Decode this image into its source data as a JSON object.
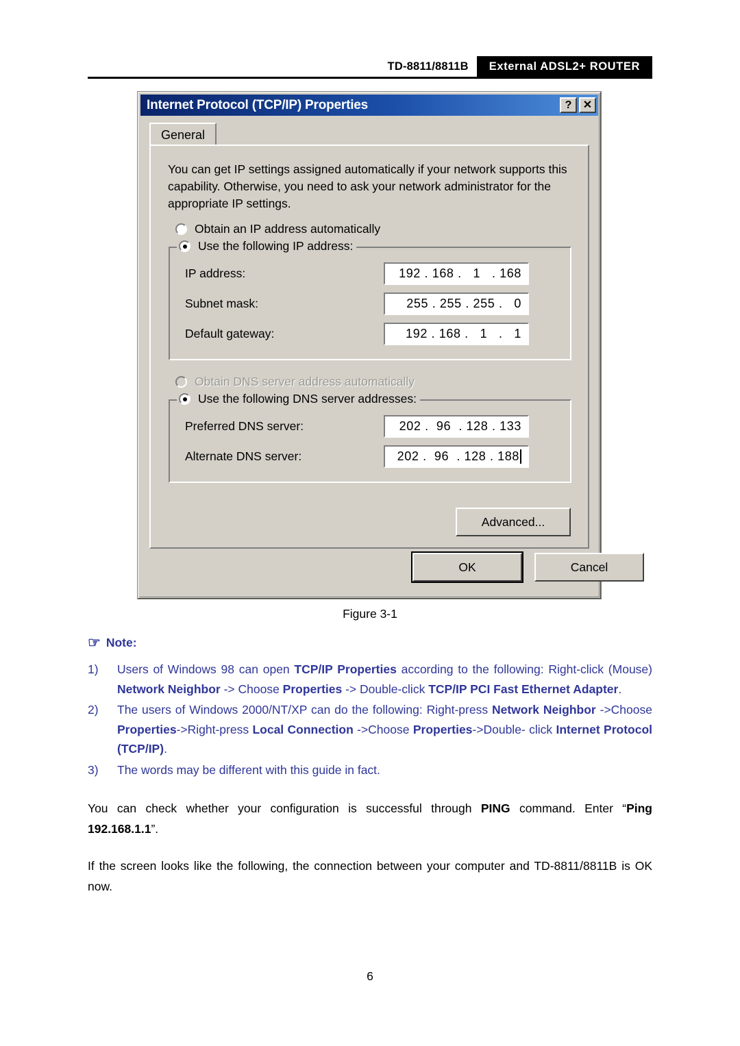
{
  "header": {
    "model": "TD-8811/8811B",
    "product": "External  ADSL2+  ROUTER"
  },
  "dialog": {
    "title": "Internet Protocol (TCP/IP) Properties",
    "help_button": "?",
    "close_button": "✕",
    "tab": "General",
    "description": "You can get IP settings assigned automatically if your network supports this capability. Otherwise, you need to ask your network administrator for the appropriate IP settings.",
    "ip_section": {
      "obtain_auto_label_pre": "O",
      "obtain_auto_label_accel": "b",
      "obtain_auto_label_post": "tain an IP address automatically",
      "obtain_auto_label": "Obtain an IP address automatically",
      "obtain_auto_selected": false,
      "use_following_label": "Use the following IP address:",
      "use_following_selected": true,
      "fields": [
        {
          "label": "IP address:",
          "value": "192 . 168 .   1   . 168",
          "caret": false
        },
        {
          "label": "Subnet mask:",
          "value": "255 . 255 . 255 .   0",
          "caret": false
        },
        {
          "label": "Default gateway:",
          "value": "192 . 168 .   1   .   1",
          "caret": false
        }
      ]
    },
    "dns_section": {
      "obtain_auto_label": "Obtain DNS server address automatically",
      "obtain_auto_selected": false,
      "obtain_auto_disabled": true,
      "use_following_label": "Use the following DNS server addresses:",
      "use_following_selected": true,
      "fields": [
        {
          "label": "Preferred DNS server:",
          "value": "202 .  96  . 128 . 133",
          "caret": false
        },
        {
          "label": "Alternate DNS server:",
          "value": "202 .  96  . 128 . 188",
          "caret": true
        }
      ]
    },
    "buttons": {
      "advanced": "Advanced...",
      "ok": "OK",
      "cancel": "Cancel"
    }
  },
  "figure_caption": "Figure 3-1",
  "note": {
    "icon": "pointing-hand-icon",
    "heading": "Note:",
    "items": [
      {
        "number": "1)",
        "html": "Users of Windows 98 can open <b>TCP/IP Properties</b> according to the following: Right-click (Mouse) <b>Network Neighbor</b> -&gt; Choose <b>Properties</b> -&gt; Double-click <b>TCP/IP PCI Fast Ethernet Adapter</b>."
      },
      {
        "number": "2)",
        "html": "The users of Windows 2000/NT/XP can do the following: Right-press <b>Network Neighbor</b> -&gt;Choose <b>Properties</b>-&gt;Right-press <b>Local Connection</b> -&gt;Choose <b>Properties</b>-&gt;Double- click <b>Internet Protocol (TCP/IP)</b>."
      },
      {
        "number": "3)",
        "html": "The words may be different with this guide in fact."
      }
    ]
  },
  "body_paragraphs": [
    {
      "id": "para-ping",
      "html": "You can check whether your configuration is successful through <b>PING</b> command. Enter &ldquo;<b>Ping 192.168.1.1</b>&rdquo;."
    },
    {
      "id": "para-screen",
      "html": "If the screen looks like the following, the connection between your computer and TD-8811/8811B is OK now."
    }
  ],
  "page_number": "6"
}
